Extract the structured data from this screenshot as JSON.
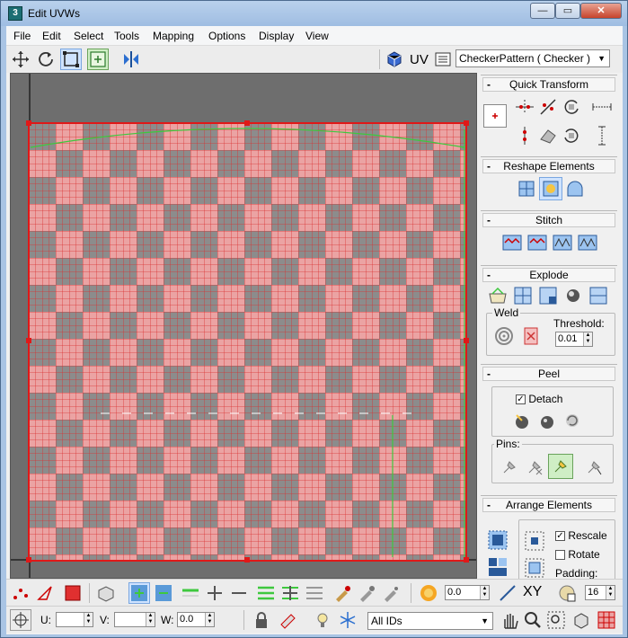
{
  "window": {
    "title": "Edit UVWs",
    "minimize": "—",
    "maximize": "▭",
    "close": "✕"
  },
  "menu": [
    "File",
    "Edit",
    "Select",
    "Tools",
    "Mapping",
    "Options",
    "Display",
    "View"
  ],
  "toolbar": {
    "uv_label": "UV",
    "texture_combo": "CheckerPattern  ( Checker )"
  },
  "panels": {
    "quick_transform": "Quick Transform",
    "reshape": "Reshape Elements",
    "stitch": "Stitch",
    "explode": "Explode",
    "weld_label": "Weld",
    "threshold_label": "Threshold:",
    "threshold_value": "0.01",
    "peel": "Peel",
    "detach_label": "Detach",
    "detach_checked": true,
    "pins_label": "Pins:",
    "arrange": "Arrange Elements",
    "rescale_label": "Rescale",
    "rescale_checked": true,
    "rotate_label": "Rotate",
    "rotate_checked": false,
    "padding_label": "Padding:",
    "collapse_marker": "-"
  },
  "bottom": {
    "soft_value": "0.0",
    "xy_label": "XY",
    "grid_value": "16",
    "u_label": "U:",
    "v_label": "V:",
    "w_label": "W:",
    "w_value": "0.0",
    "ids_combo": "All IDs"
  },
  "colors": {
    "checker_light": "#eba3a3",
    "checker_dark": "#8c8c8c",
    "uv_edges": "#d62020",
    "accent_green": "#3ec83e"
  }
}
